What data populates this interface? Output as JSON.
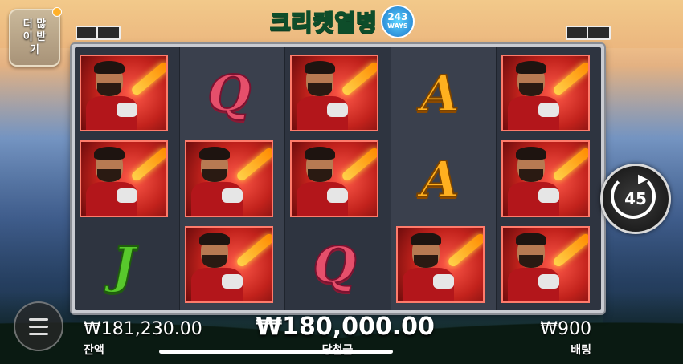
{
  "header": {
    "more_button_label": "더 많이 받기",
    "logo_title": "크리켓열병",
    "ways_number": "243",
    "ways_label": "WAYS"
  },
  "reels": [
    [
      "cricketer",
      "cricketer",
      "J"
    ],
    [
      "Q",
      "cricketer",
      "cricketer"
    ],
    [
      "cricketer",
      "cricketer",
      "Q"
    ],
    [
      "A",
      "A",
      "cricketer"
    ],
    [
      "cricketer",
      "cricketer",
      "cricketer"
    ]
  ],
  "spin_counter": {
    "value": "45"
  },
  "footer": {
    "balance_value": "₩181,230.00",
    "balance_label": "잔액",
    "win_value": "₩180,000.00",
    "win_label": "당첨금",
    "bet_value": "₩900",
    "bet_label": "배팅"
  },
  "icons": {
    "menu": "hamburger-icon",
    "spin": "auto-spin-icon",
    "cricketer": "cricketer-symbol-icon"
  },
  "colors": {
    "logo_green": "#4fd06a",
    "player_red": "#c2221c",
    "q_pink": "#e54f6b",
    "a_gold": "#ffb01f",
    "j_green": "#58c92c"
  }
}
